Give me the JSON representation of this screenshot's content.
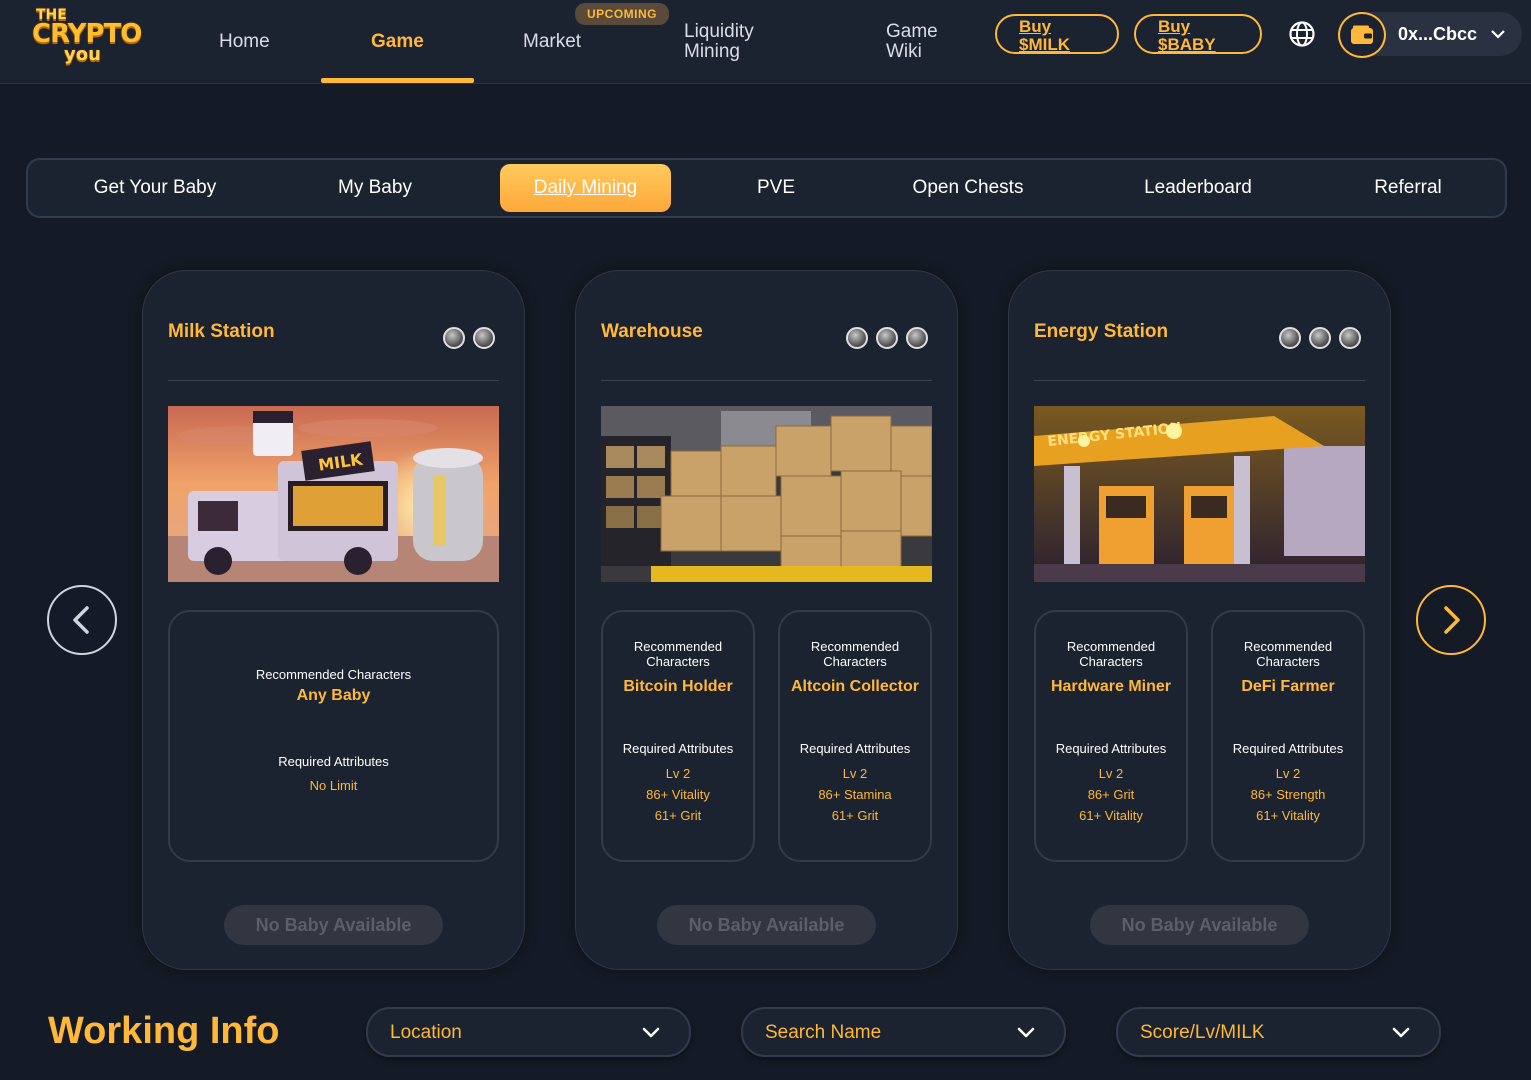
{
  "logo": {
    "line1": "THE",
    "line2": "CRYPTO",
    "line3": "you"
  },
  "nav": {
    "home": "Home",
    "game": "Game",
    "market": "Market",
    "upcoming_badge": "UPCOMING",
    "liquidity_l1": "Liquidity",
    "liquidity_l2": "Mining",
    "wiki_l1": "Game",
    "wiki_l2": "Wiki",
    "buy_milk_l1": "Buy",
    "buy_milk_l2": "$MILK",
    "buy_baby_l1": "Buy",
    "buy_baby_l2": "$BABY",
    "wallet_address": "0x...Cbcc"
  },
  "subtabs": [
    "Get Your Baby",
    "My Baby",
    "Daily Mining",
    "PVE",
    "Open Chests",
    "Leaderboard",
    "Referral"
  ],
  "active_subtab": "Daily Mining",
  "cards": [
    {
      "title": "Milk Station",
      "difficulty_icons": 2,
      "rec_label": "Recommended Characters",
      "rec_value": "Any Baby",
      "req_label": "Required Attributes",
      "req_value": "No Limit",
      "button": "No Baby Available"
    },
    {
      "title": "Warehouse",
      "difficulty_icons": 3,
      "boxes": [
        {
          "rec_label_1": "Recommended",
          "rec_label_2": "Characters",
          "rec_value": "Bitcoin Holder",
          "req_label": "Required Attributes",
          "attrs": [
            "Lv 2",
            "86+ Vitality",
            "61+ Grit"
          ]
        },
        {
          "rec_label_1": "Recommended",
          "rec_label_2": "Characters",
          "rec_value": "Altcoin Collector",
          "req_label": "Required Attributes",
          "attrs": [
            "Lv 2",
            "86+ Stamina",
            "61+ Grit"
          ]
        }
      ],
      "button": "No Baby Available"
    },
    {
      "title": "Energy Station",
      "difficulty_icons": 3,
      "image_sign": "ENERGY STATION",
      "boxes": [
        {
          "rec_label_1": "Recommended",
          "rec_label_2": "Characters",
          "rec_value": "Hardware Miner",
          "req_label": "Required Attributes",
          "attrs": [
            "Lv 2",
            "86+ Grit",
            "61+ Vitality"
          ]
        },
        {
          "rec_label_1": "Recommended",
          "rec_label_2": "Characters",
          "rec_value": "DeFi Farmer",
          "req_label": "Required Attributes",
          "attrs": [
            "Lv 2",
            "86+ Strength",
            "61+ Vitality"
          ]
        }
      ],
      "button": "No Baby Available"
    }
  ],
  "milk_truck_sign": "MILK",
  "working_info": {
    "title": "Working Info",
    "filters": [
      "Location",
      "Search Name",
      "Score/Lv/MILK"
    ]
  },
  "colors": {
    "accent": "#ffb83a",
    "bg": "#151b26",
    "panel": "#1b2230"
  },
  "icons": {
    "globe": "globe-icon",
    "wallet": "wallet-icon",
    "chevron": "chevron-down-icon",
    "prev": "chevron-left-icon",
    "next": "chevron-right-icon",
    "difficulty": "baby-head-icon"
  }
}
